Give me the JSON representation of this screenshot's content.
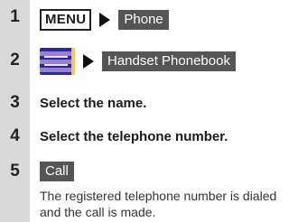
{
  "steps": [
    {
      "number": "1",
      "menu_key": "MENU",
      "soft_key": "Phone"
    },
    {
      "number": "2",
      "icon": "phonebook-icon",
      "soft_key": "Handset Phonebook"
    },
    {
      "number": "3",
      "text": "Select the name."
    },
    {
      "number": "4",
      "text": "Select the telephone number."
    },
    {
      "number": "5",
      "soft_key": "Call",
      "note": "The registered telephone number is dialed and the call is made."
    }
  ],
  "colors": {
    "number_column": "#d9d9d9",
    "soft_key_background": "#555555",
    "soft_key_text": "#ffffff"
  }
}
